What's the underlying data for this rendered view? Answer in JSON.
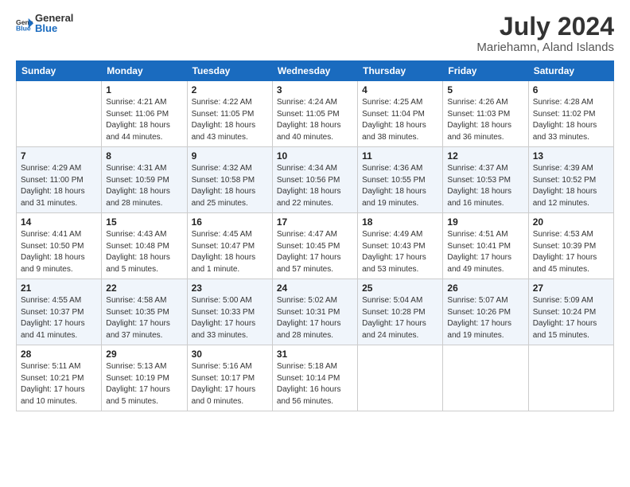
{
  "logo": {
    "general": "General",
    "blue": "Blue"
  },
  "title": "July 2024",
  "subtitle": "Mariehamn, Aland Islands",
  "headers": [
    "Sunday",
    "Monday",
    "Tuesday",
    "Wednesday",
    "Thursday",
    "Friday",
    "Saturday"
  ],
  "weeks": [
    [
      {
        "day": "",
        "info": ""
      },
      {
        "day": "1",
        "info": "Sunrise: 4:21 AM\nSunset: 11:06 PM\nDaylight: 18 hours\nand 44 minutes."
      },
      {
        "day": "2",
        "info": "Sunrise: 4:22 AM\nSunset: 11:05 PM\nDaylight: 18 hours\nand 43 minutes."
      },
      {
        "day": "3",
        "info": "Sunrise: 4:24 AM\nSunset: 11:05 PM\nDaylight: 18 hours\nand 40 minutes."
      },
      {
        "day": "4",
        "info": "Sunrise: 4:25 AM\nSunset: 11:04 PM\nDaylight: 18 hours\nand 38 minutes."
      },
      {
        "day": "5",
        "info": "Sunrise: 4:26 AM\nSunset: 11:03 PM\nDaylight: 18 hours\nand 36 minutes."
      },
      {
        "day": "6",
        "info": "Sunrise: 4:28 AM\nSunset: 11:02 PM\nDaylight: 18 hours\nand 33 minutes."
      }
    ],
    [
      {
        "day": "7",
        "info": "Sunrise: 4:29 AM\nSunset: 11:00 PM\nDaylight: 18 hours\nand 31 minutes."
      },
      {
        "day": "8",
        "info": "Sunrise: 4:31 AM\nSunset: 10:59 PM\nDaylight: 18 hours\nand 28 minutes."
      },
      {
        "day": "9",
        "info": "Sunrise: 4:32 AM\nSunset: 10:58 PM\nDaylight: 18 hours\nand 25 minutes."
      },
      {
        "day": "10",
        "info": "Sunrise: 4:34 AM\nSunset: 10:56 PM\nDaylight: 18 hours\nand 22 minutes."
      },
      {
        "day": "11",
        "info": "Sunrise: 4:36 AM\nSunset: 10:55 PM\nDaylight: 18 hours\nand 19 minutes."
      },
      {
        "day": "12",
        "info": "Sunrise: 4:37 AM\nSunset: 10:53 PM\nDaylight: 18 hours\nand 16 minutes."
      },
      {
        "day": "13",
        "info": "Sunrise: 4:39 AM\nSunset: 10:52 PM\nDaylight: 18 hours\nand 12 minutes."
      }
    ],
    [
      {
        "day": "14",
        "info": "Sunrise: 4:41 AM\nSunset: 10:50 PM\nDaylight: 18 hours\nand 9 minutes."
      },
      {
        "day": "15",
        "info": "Sunrise: 4:43 AM\nSunset: 10:48 PM\nDaylight: 18 hours\nand 5 minutes."
      },
      {
        "day": "16",
        "info": "Sunrise: 4:45 AM\nSunset: 10:47 PM\nDaylight: 18 hours\nand 1 minute."
      },
      {
        "day": "17",
        "info": "Sunrise: 4:47 AM\nSunset: 10:45 PM\nDaylight: 17 hours\nand 57 minutes."
      },
      {
        "day": "18",
        "info": "Sunrise: 4:49 AM\nSunset: 10:43 PM\nDaylight: 17 hours\nand 53 minutes."
      },
      {
        "day": "19",
        "info": "Sunrise: 4:51 AM\nSunset: 10:41 PM\nDaylight: 17 hours\nand 49 minutes."
      },
      {
        "day": "20",
        "info": "Sunrise: 4:53 AM\nSunset: 10:39 PM\nDaylight: 17 hours\nand 45 minutes."
      }
    ],
    [
      {
        "day": "21",
        "info": "Sunrise: 4:55 AM\nSunset: 10:37 PM\nDaylight: 17 hours\nand 41 minutes."
      },
      {
        "day": "22",
        "info": "Sunrise: 4:58 AM\nSunset: 10:35 PM\nDaylight: 17 hours\nand 37 minutes."
      },
      {
        "day": "23",
        "info": "Sunrise: 5:00 AM\nSunset: 10:33 PM\nDaylight: 17 hours\nand 33 minutes."
      },
      {
        "day": "24",
        "info": "Sunrise: 5:02 AM\nSunset: 10:31 PM\nDaylight: 17 hours\nand 28 minutes."
      },
      {
        "day": "25",
        "info": "Sunrise: 5:04 AM\nSunset: 10:28 PM\nDaylight: 17 hours\nand 24 minutes."
      },
      {
        "day": "26",
        "info": "Sunrise: 5:07 AM\nSunset: 10:26 PM\nDaylight: 17 hours\nand 19 minutes."
      },
      {
        "day": "27",
        "info": "Sunrise: 5:09 AM\nSunset: 10:24 PM\nDaylight: 17 hours\nand 15 minutes."
      }
    ],
    [
      {
        "day": "28",
        "info": "Sunrise: 5:11 AM\nSunset: 10:21 PM\nDaylight: 17 hours\nand 10 minutes."
      },
      {
        "day": "29",
        "info": "Sunrise: 5:13 AM\nSunset: 10:19 PM\nDaylight: 17 hours\nand 5 minutes."
      },
      {
        "day": "30",
        "info": "Sunrise: 5:16 AM\nSunset: 10:17 PM\nDaylight: 17 hours\nand 0 minutes."
      },
      {
        "day": "31",
        "info": "Sunrise: 5:18 AM\nSunset: 10:14 PM\nDaylight: 16 hours\nand 56 minutes."
      },
      {
        "day": "",
        "info": ""
      },
      {
        "day": "",
        "info": ""
      },
      {
        "day": "",
        "info": ""
      }
    ]
  ]
}
